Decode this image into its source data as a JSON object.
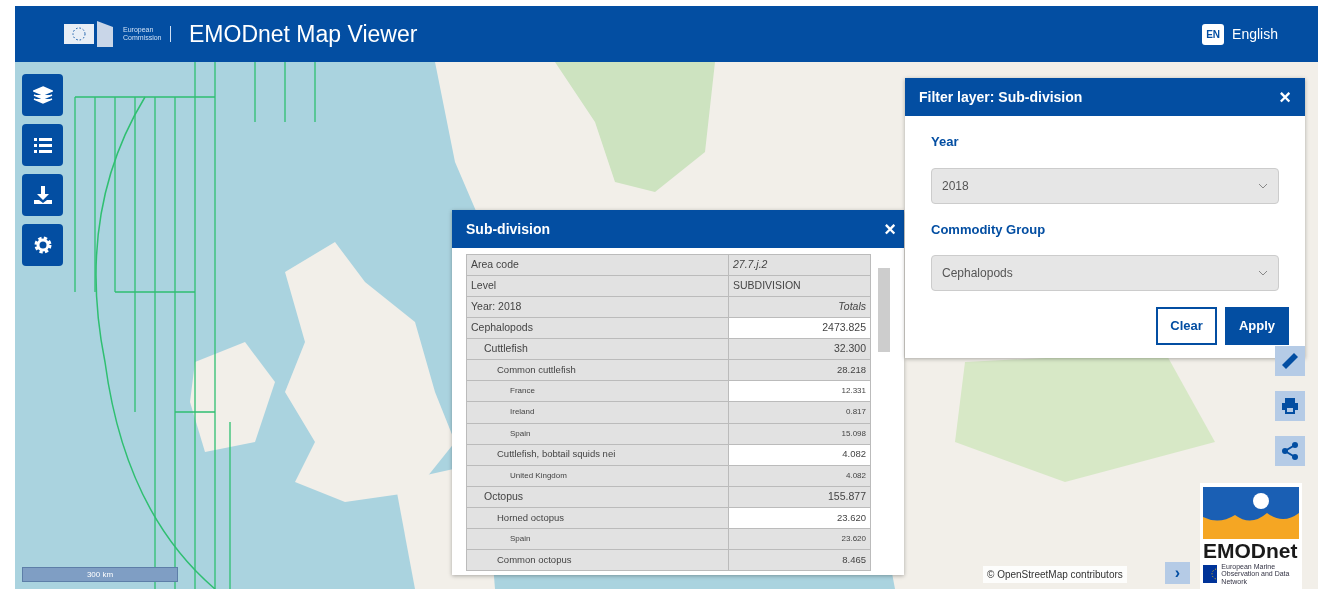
{
  "header": {
    "org_name": "European Commission",
    "title": "EMODnet Map Viewer",
    "lang_code": "EN",
    "language": "English"
  },
  "toolbar": [
    {
      "kind": "layers"
    },
    {
      "kind": "list"
    },
    {
      "kind": "download"
    },
    {
      "kind": "settings"
    }
  ],
  "info_panel": {
    "title": "Sub-division",
    "close": "×",
    "fields": [
      {
        "label": "Area code",
        "value": "27.7.j.2"
      },
      {
        "label": "Level",
        "value": "SUBDIVISION"
      }
    ],
    "year_row": {
      "label": "Year: 2018",
      "value": "Totals"
    },
    "rows": [
      {
        "label": "Cephalopods",
        "value": "2473.825",
        "children": [
          {
            "label": "Cuttlefish",
            "value": "32.300",
            "children": [
              {
                "label": "Common cuttlefish",
                "value": "28.218",
                "children": [
                  {
                    "label": "France",
                    "value": "12.331"
                  },
                  {
                    "label": "Ireland",
                    "value": "0.817"
                  },
                  {
                    "label": "Spain",
                    "value": "15.098"
                  }
                ]
              },
              {
                "label": "Cuttlefish, bobtail squids nei",
                "value": "4.082",
                "children": [
                  {
                    "label": "United Kingdom",
                    "value": "4.082"
                  }
                ]
              }
            ]
          },
          {
            "label": "Octopus",
            "value": "155.877",
            "children": [
              {
                "label": "Horned octopus",
                "value": "23.620",
                "children": [
                  {
                    "label": "Spain",
                    "value": "23.620"
                  }
                ]
              },
              {
                "label": "Common octopus",
                "value": "8.465"
              }
            ]
          }
        ]
      }
    ]
  },
  "filter_panel": {
    "title": "Filter layer: Sub-division",
    "close": "×",
    "fields": [
      {
        "label": "Year",
        "value": "2018"
      },
      {
        "label": "Commodity Group",
        "value": "Cephalopods"
      }
    ],
    "buttons": [
      {
        "label": "Clear",
        "kind": "secondary"
      },
      {
        "label": "Apply",
        "kind": "primary"
      }
    ]
  },
  "map_tools": [
    {
      "kind": "ruler"
    },
    {
      "kind": "print"
    },
    {
      "kind": "share"
    }
  ],
  "scale": "300 km",
  "attribution": {
    "link": "OpenStreetMap",
    "text": "contributors",
    "symbol": "©",
    "expand": "›"
  },
  "brand": {
    "name": "EMODnet",
    "subtitle": "European Marine Observation and Data Network"
  }
}
